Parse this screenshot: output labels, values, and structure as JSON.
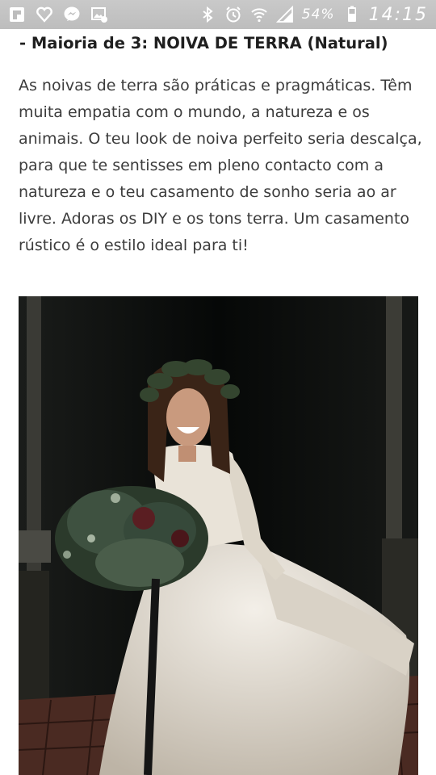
{
  "status_bar": {
    "left_icons": [
      "flipboard-icon",
      "heart-icon",
      "messenger-icon",
      "gallery-icon"
    ],
    "right_icons": [
      "bluetooth-icon",
      "alarm-icon",
      "wifi-icon",
      "signal-icon"
    ],
    "battery_percent": "54%",
    "time": "14:15"
  },
  "article": {
    "heading": "- Maioria de 3: NOIVA DE TERRA (Natural)",
    "paragraph": "As noivas de terra são práticas e pragmáticas. Têm muita empatia com o mundo, a natureza e os animais. O teu look de noiva perfeito seria descalça, para que te sentisses em pleno contacto com a natureza e o teu casamento de sonho seria ao ar livre. Adoras os DIY e os tons terra. Um casamento rústico é o estilo ideal para ti!"
  },
  "colors": {
    "status_bar_bg": "#c3c3c3",
    "photo_bg": "#0b0d0c",
    "dress": "#e8e1d6",
    "bouquet": "#3a4a3a"
  }
}
